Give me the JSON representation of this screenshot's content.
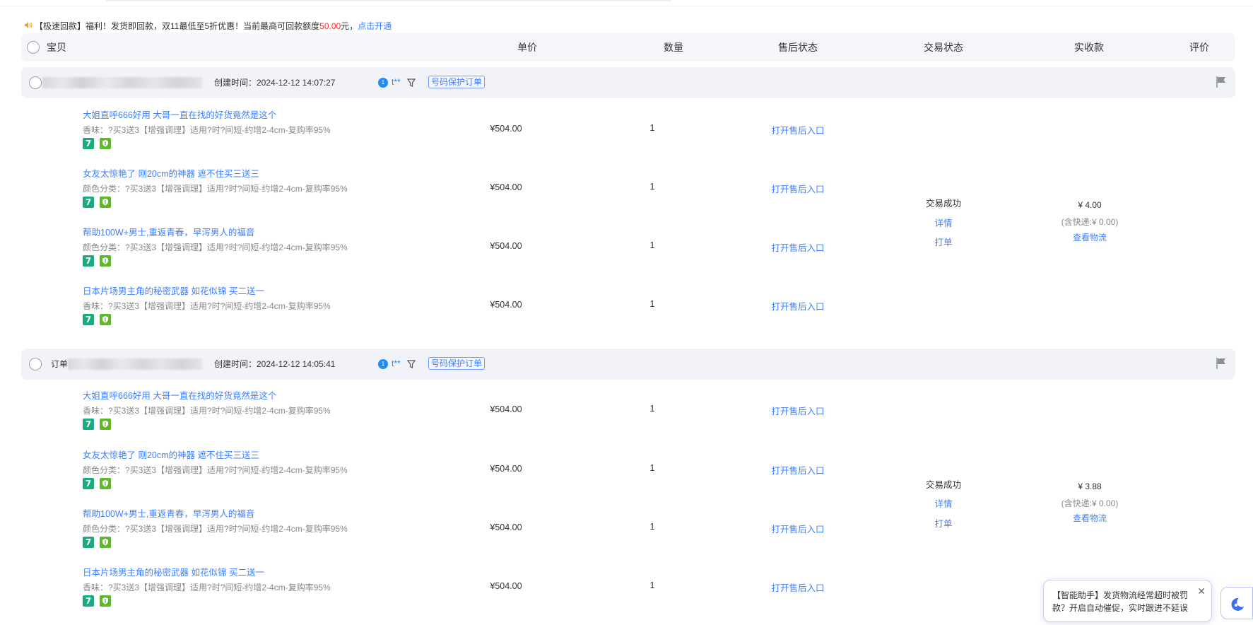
{
  "notice": {
    "icon": "speaker-icon",
    "prefix": "【极速回款】福利！发货即回款，双11最低至5折优惠！当前最高可回款额度",
    "amount": "50.00",
    "suffix": "元，",
    "link": "点击开通"
  },
  "header": {
    "cols": [
      "宝贝",
      "单价",
      "数量",
      "售后状态",
      "交易状态",
      "实收款",
      "评价"
    ]
  },
  "orders": [
    {
      "id_label": "",
      "created": "创建时间：2024-12-12 14:07:27",
      "buyer": "t**",
      "badge": "号码保护订单",
      "status": "交易成功",
      "detail": "详情",
      "print": "打单",
      "amount": "¥ 4.00",
      "shipping": "(含快递:¥ 0.00)",
      "logistics": "查看物流",
      "items": [
        {
          "title": "大姐直呼666好用 大哥一直在找的好货竟然是这个",
          "spec": "香味：?买3送3【增强调理】适用?时?间短-约增2-4cm-复购率95%",
          "price": "¥504.00",
          "qty": "1",
          "after_sale": "打开售后入口"
        },
        {
          "title": "女友太惊艳了 刚20cm的神器 遮不住买三送三",
          "spec": "颜色分类：?买3送3【增强调理】适用?时?间短-约增2-4cm-复购率95%",
          "price": "¥504.00",
          "qty": "1",
          "after_sale": "打开售后入口"
        },
        {
          "title": "帮助100W+男士,重返青春，早泻男人的福音",
          "spec": "颜色分类：?买3送3【增强调理】适用?时?间短-约增2-4cm-复购率95%",
          "price": "¥504.00",
          "qty": "1",
          "after_sale": "打开售后入口"
        },
        {
          "title": "日本片场男主角的秘密武器 如花似锦 买二送一",
          "spec": "香味：?买3送3【增强调理】适用?时?间短-约增2-4cm-复购率95%",
          "price": "¥504.00",
          "qty": "1",
          "after_sale": "打开售后入口"
        }
      ]
    },
    {
      "id_label": "订单",
      "created": "创建时间：2024-12-12 14:05:41",
      "buyer": "t**",
      "badge": "号码保护订单",
      "status": "交易成功",
      "detail": "详情",
      "print": "打单",
      "amount": "¥ 3.88",
      "shipping": "(含快递:¥ 0.00)",
      "logistics": "查看物流",
      "items": [
        {
          "title": "大姐直呼666好用 大哥一直在找的好货竟然是这个",
          "spec": "香味：?买3送3【增强调理】适用?时?间短-约增2-4cm-复购率95%",
          "price": "¥504.00",
          "qty": "1",
          "after_sale": "打开售后入口"
        },
        {
          "title": "女友太惊艳了 刚20cm的神器 遮不住买三送三",
          "spec": "颜色分类：?买3送3【增强调理】适用?时?间短-约增2-4cm-复购率95%",
          "price": "¥504.00",
          "qty": "1",
          "after_sale": "打开售后入口"
        },
        {
          "title": "帮助100W+男士,重返青春，早泻男人的福音",
          "spec": "颜色分类：?买3送3【增强调理】适用?时?间短-约增2-4cm-复购率95%",
          "price": "¥504.00",
          "qty": "1",
          "after_sale": "打开售后入口"
        },
        {
          "title": "日本片场男主角的秘密武器 如花似锦 买二送一",
          "spec": "香味：?买3送3【增强调理】适用?时?间短-约增2-4cm-复购率95%",
          "price": "¥504.00",
          "qty": "1",
          "after_sale": "打开售后入口"
        }
      ]
    }
  ],
  "helper": {
    "text": "【智能助手】发货物流经常超时被罚款？开启自动催促，实时跟进不延误",
    "close": "✕"
  },
  "colors": {
    "link": "#3d7fff",
    "alert": "#ff2d2d",
    "badge": "#4a7fe8",
    "icon_green": "#1aaa82"
  }
}
